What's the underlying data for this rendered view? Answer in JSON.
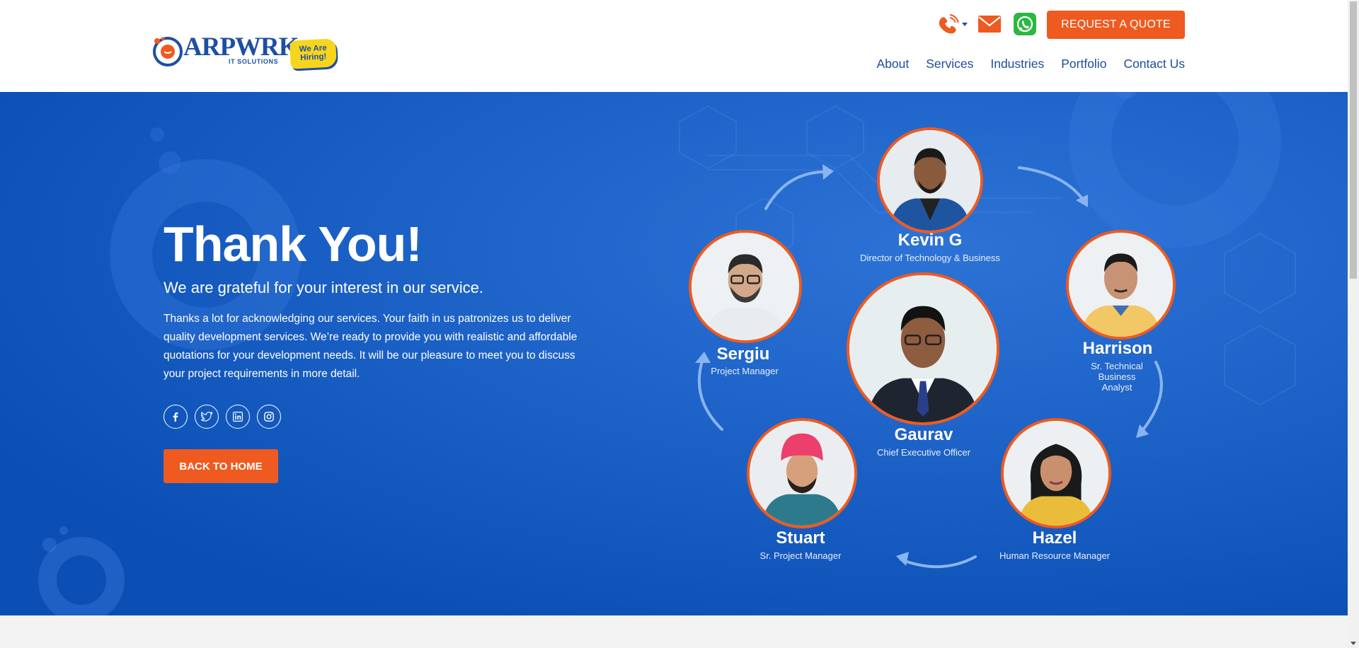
{
  "header": {
    "logo": {
      "word": "ARPWRK",
      "sub": "IT SOLUTIONS",
      "badge_line1": "We Are",
      "badge_line2": "Hiring!"
    },
    "quote_label": "REQUEST A QUOTE",
    "nav": [
      "About",
      "Services",
      "Industries",
      "Portfolio",
      "Contact Us"
    ]
  },
  "hero": {
    "title": "Thank You!",
    "subtitle": "We are grateful for your interest in our service.",
    "body": "Thanks a lot for acknowledging our services. Your faith in us patronizes us to deliver quality development services. We’re ready to provide you with realistic and affordable quotations for your development needs. It will be our pleasure to meet you to discuss your project requirements in more detail.",
    "back_label": "BACK TO HOME",
    "socials": [
      "facebook-icon",
      "twitter-icon",
      "linkedin-icon",
      "instagram-icon"
    ]
  },
  "team": [
    {
      "name": "Kevin G",
      "role": "Director of Technology & Business"
    },
    {
      "name": "Sergiu",
      "role": "Project Manager"
    },
    {
      "name": "Harrison",
      "role_lines": [
        "Sr. Technical",
        "Business",
        "Analyst"
      ]
    },
    {
      "name": "Gaurav",
      "role": "Chief Executive Officer"
    },
    {
      "name": "Stuart",
      "role": "Sr. Project Manager"
    },
    {
      "name": "Hazel",
      "role": "Human Resource Manager"
    }
  ],
  "colors": {
    "brand_blue": "#1d4fa3",
    "hero_blue": "#0d58c2",
    "accent_orange": "#ee5a1f"
  }
}
